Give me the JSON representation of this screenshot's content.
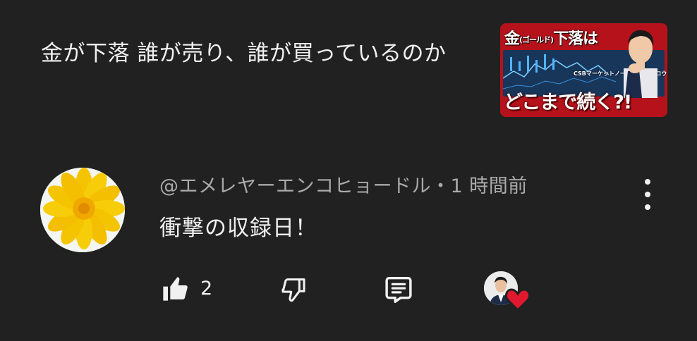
{
  "video": {
    "title": "金が下落 誰が売り、誰が買っているのか",
    "thumbnail": {
      "headline_main": "金",
      "headline_small": "(ゴールド)",
      "headline_rest": "下落は",
      "caption": "CSBマーケットノーズ カツキタロウ",
      "subheadline": "どこまで続く?!"
    }
  },
  "comment": {
    "author_handle": "@エメレヤーエンコヒョードル",
    "separator": "・",
    "timestamp": "1 時間前",
    "text": "衝撃の収録日！",
    "like_count": "2",
    "icons": {
      "menu": "more-vert-icon",
      "like": "thumb-up-icon",
      "dislike": "thumb-down-icon",
      "reply": "comment-reply-icon",
      "hearted": "creator-heart-icon"
    }
  },
  "colors": {
    "background": "#212121",
    "primary_text": "#f1f1f1",
    "secondary_text": "#aaaaaa",
    "heart": "#e0192e",
    "thumbnail_red": "#b5121b"
  }
}
